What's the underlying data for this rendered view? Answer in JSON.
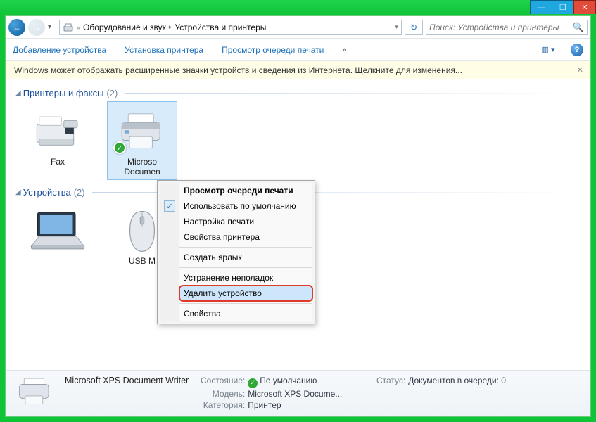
{
  "window": {
    "minimize": "—",
    "maximize": "❐",
    "close": "✕"
  },
  "nav": {
    "crumb1": "Оборудование и звук",
    "crumb2": "Устройства и принтеры",
    "search_placeholder": "Поиск: Устройства и принтеры"
  },
  "toolbar": {
    "add_device": "Добавление устройства",
    "add_printer": "Установка принтера",
    "view_queue": "Просмотр очереди печати",
    "more": "»"
  },
  "infobar": {
    "text": "Windows может отображать расширенные значки устройств и сведения из Интернета.  Щелкните для изменения...",
    "close": "✕"
  },
  "groups": {
    "printers": {
      "title": "Принтеры и факсы",
      "count": "(2)"
    },
    "devices": {
      "title": "Устройства",
      "count": "(2)"
    }
  },
  "items": {
    "fax": "Fax",
    "xps": "Microsoft XPS Document Writer",
    "xps_short1": "Microso",
    "xps_short2": "Documen",
    "usb_mouse": "USB M",
    "laptop": ""
  },
  "context_menu": {
    "queue": "Просмотр очереди печати",
    "default": "Использовать по умолчанию",
    "pref": "Настройка печати",
    "props_printer": "Свойства принтера",
    "shortcut": "Создать ярлык",
    "troubleshoot": "Устранение неполадок",
    "remove": "Удалить устройство",
    "props": "Свойства"
  },
  "details": {
    "name": "Microsoft XPS Document Writer",
    "state_k": "Состояние:",
    "state_v": "По умолчанию",
    "model_k": "Модель:",
    "model_v": "Microsoft XPS Docume...",
    "cat_k": "Категория:",
    "cat_v": "Принтер",
    "status_k": "Статус:",
    "status_v": "Документов в очереди: 0"
  }
}
